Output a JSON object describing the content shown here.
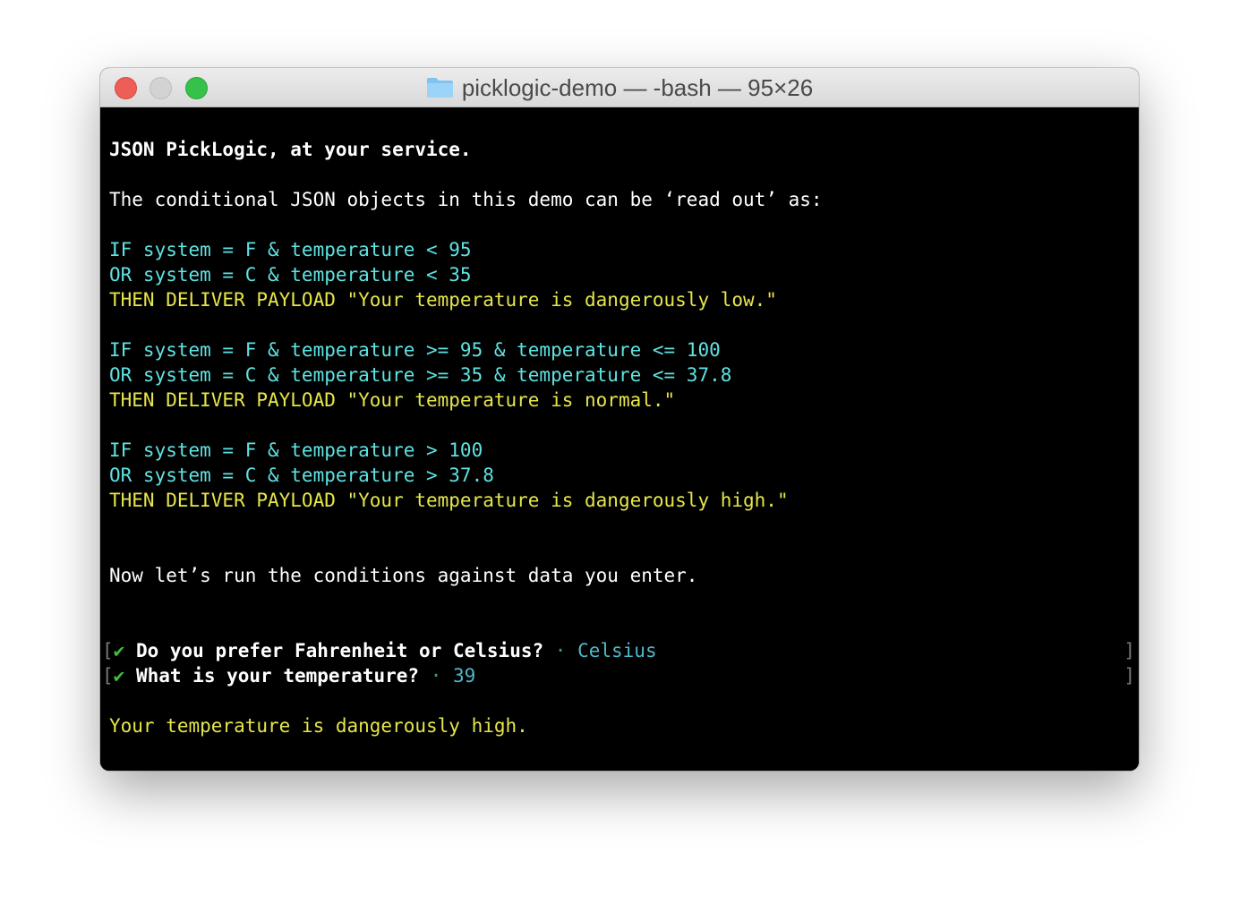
{
  "window": {
    "title": "picklogic-demo — -bash — 95×26"
  },
  "colors": {
    "condition": "#5fe3e3",
    "payload": "#e6e64a",
    "answer": "#4fb8c8",
    "check": "#3fbf3f"
  },
  "terminal": {
    "greeting": "JSON PickLogic, at your service.",
    "intro": "The conditional JSON objects in this demo can be ‘read out’ as:",
    "rules": [
      {
        "if_line": "IF system = F & temperature < 95",
        "or_line": "OR system = C & temperature < 35",
        "then_line": "THEN DELIVER PAYLOAD \"Your temperature is dangerously low.\""
      },
      {
        "if_line": "IF system = F & temperature >= 95 & temperature <= 100",
        "or_line": "OR system = C & temperature >= 35 & temperature <= 37.8",
        "then_line": "THEN DELIVER PAYLOAD \"Your temperature is normal.\""
      },
      {
        "if_line": "IF system = F & temperature > 100",
        "or_line": "OR system = C & temperature > 37.8",
        "then_line": "THEN DELIVER PAYLOAD \"Your temperature is dangerously high.\""
      }
    ],
    "run_text": "Now let’s run the conditions against data you enter.",
    "prompts": [
      {
        "bracket_open": "[",
        "check": "✔",
        "question": "Do you prefer Fahrenheit or Celsius?",
        "separator": "·",
        "answer": "Celsius",
        "bracket_close": "]"
      },
      {
        "bracket_open": "[",
        "check": "✔",
        "question": "What is your temperature?",
        "separator": "·",
        "answer": "39",
        "bracket_close": "]"
      }
    ],
    "result": "Your temperature is dangerously high."
  }
}
